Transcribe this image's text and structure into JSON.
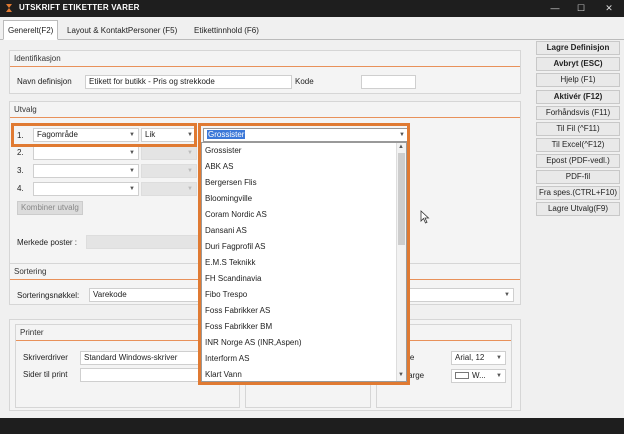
{
  "window": {
    "title": "UTSKRIFT  ETIKETTER VARER",
    "minimize": "—",
    "maximize": "☐",
    "close": "✕"
  },
  "tabs": [
    {
      "label": "Generelt(F2)"
    },
    {
      "label": "Layout & KontaktPersoner (F5)"
    },
    {
      "label": "Etikettinnhold (F6)"
    }
  ],
  "identifikasjon": {
    "header": "Identifikasjon",
    "name_label": "Navn definisjon",
    "name_value": "Etikett for butikk - Pris og strekkode",
    "kode_label": "Kode",
    "kode_value": ""
  },
  "utvalg": {
    "header": "Utvalg",
    "rows": [
      {
        "num": "1.",
        "field": "Fagområde",
        "op": "Lik",
        "value": "Grossister"
      },
      {
        "num": "2.",
        "field": "",
        "op": "",
        "value": ""
      },
      {
        "num": "3.",
        "field": "",
        "op": "",
        "value": ""
      },
      {
        "num": "4.",
        "field": "",
        "op": "",
        "value": ""
      }
    ],
    "combine_label": "Kombiner utvalg"
  },
  "merkede": {
    "label": "Merkede poster :"
  },
  "sortering": {
    "header": "Sortering",
    "key_label": "Sorteringsnøkkel:",
    "key_value": "Varekode"
  },
  "printer": {
    "header": "Printer",
    "driver_label": "Skriverdriver",
    "driver_value": "Standard Windows-skriver",
    "pages_label": "Sider til print",
    "pages_value": ""
  },
  "farge": {
    "header": "rge",
    "font_label": "ifttype",
    "font_value": "Arial, 12",
    "color_label": "nnsfarge",
    "color_value": "W..."
  },
  "dropdown_items": [
    "Grossister",
    "ABK AS",
    "Bergersen Flis",
    "Bloomingville",
    "Coram Nordic AS",
    "Dansani AS",
    "Duri Fagprofil AS",
    "E.M.S Teknikk",
    "FH Scandinavia",
    "Fibo Trespo",
    "Foss Fabrikker AS",
    "Foss Fabrikker BM",
    "INR Norge AS (INR,Aspen)",
    "Interform AS",
    "Klart Vann"
  ],
  "sidebar_buttons": [
    {
      "label": "Lagre Definisjon",
      "bold": true
    },
    {
      "label": "Avbryt (ESC)",
      "bold": true
    },
    {
      "label": "Hjelp (F1)",
      "bold": false
    },
    {
      "label": "Aktivér (F12)",
      "bold": true
    },
    {
      "label": "Forhåndsvis (F11)",
      "bold": false
    },
    {
      "label": "Til Fil (^F11)",
      "bold": false
    },
    {
      "label": "Til Excel(^F12)",
      "bold": false
    },
    {
      "label": "Epost (PDF-vedl.)",
      "bold": false
    },
    {
      "label": "PDF-fil",
      "bold": false
    },
    {
      "label": "Fra spes.(CTRL+F10)",
      "bold": false
    },
    {
      "label": "Lagre Utvalg(F9)",
      "bold": false
    }
  ],
  "colors": {
    "accent": "#e07a32",
    "titlebar": "#1e1e1e",
    "selection": "#3c78d8"
  }
}
